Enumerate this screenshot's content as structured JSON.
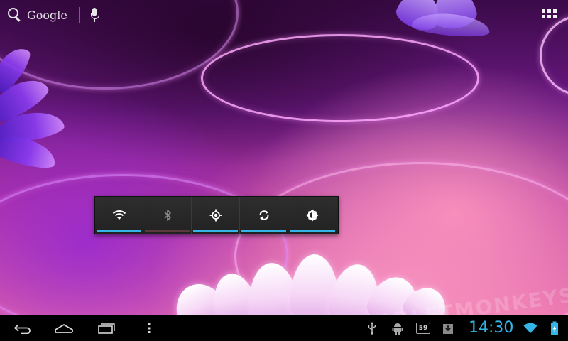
{
  "search": {
    "label": "Google"
  },
  "power_widget": {
    "buttons": [
      {
        "name": "wifi",
        "icon": "wifi-icon",
        "state": "on"
      },
      {
        "name": "bluetooth",
        "icon": "bluetooth-icon",
        "state": "off"
      },
      {
        "name": "gps",
        "icon": "gps-icon",
        "state": "on"
      },
      {
        "name": "sync",
        "icon": "sync-icon",
        "state": "on"
      },
      {
        "name": "brightness",
        "icon": "brightness-icon",
        "state": "on"
      }
    ]
  },
  "system_bar": {
    "nav": [
      {
        "name": "back",
        "icon": "back-icon"
      },
      {
        "name": "home",
        "icon": "home-icon"
      },
      {
        "name": "recent-apps",
        "icon": "recent-apps-icon"
      },
      {
        "name": "menu",
        "icon": "menu-dots-icon"
      }
    ],
    "notifications": [
      {
        "icon": "usb-icon"
      },
      {
        "icon": "android-debug-icon"
      },
      {
        "icon": "notification-count-icon",
        "text": "59"
      },
      {
        "icon": "download-icon"
      }
    ],
    "clock": "14:30",
    "status_icons": [
      "wifi-signal-icon",
      "battery-charging-icon"
    ]
  },
  "watermark": "TABLETMONKEYS",
  "colors": {
    "accent": "#33b5e5",
    "indicator_off": "#5a3a3a",
    "widget_bg": "#262626",
    "system_bar": "#000000"
  }
}
